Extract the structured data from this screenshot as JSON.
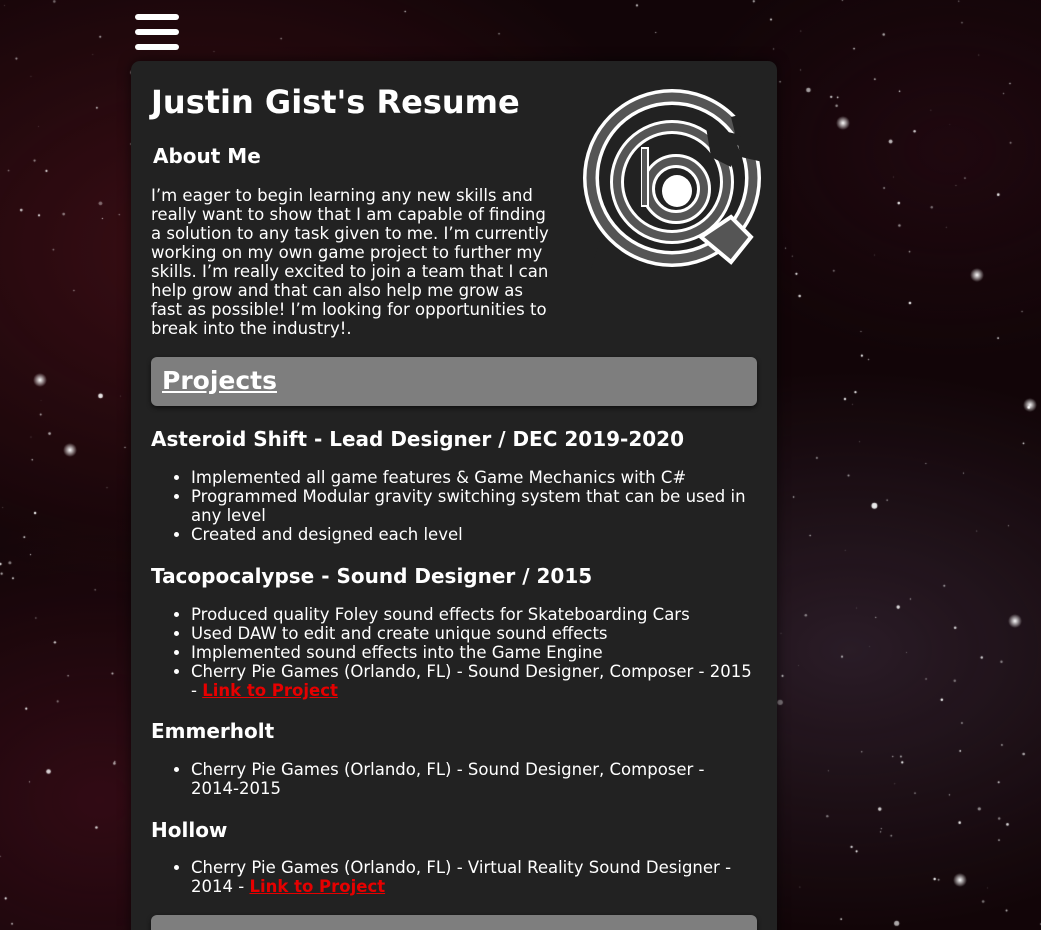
{
  "page": {
    "title": "Justin Gist's Resume"
  },
  "menu": {
    "icon": "hamburger-menu-icon"
  },
  "about": {
    "heading": "About Me",
    "text": "I’m eager to begin learning any new skills and really want to show that I am capable of finding a solution to any task given to me. I’m currently working on my own game project to further my skills. I’m really excited to join a team that I can help grow and that can also help me grow as fast as possible! I’m looking for opportunities to break into the industry!."
  },
  "logo": {
    "icon": "personal-logo-icon"
  },
  "projects_section": {
    "label": "Projects"
  },
  "projects": [
    {
      "title": "Asteroid Shift - Lead Designer / DEC 2019-2020",
      "bullets": [
        "Implemented all game features & Game Mechanics with C#",
        "Programmed Modular gravity switching system that can be used in any level",
        "Created and designed each level"
      ]
    },
    {
      "title": "Tacopocalypse - Sound Designer / 2015",
      "bullets": [
        "Produced quality Foley sound effects for Skateboarding Cars",
        "Used DAW to edit and create unique sound effects",
        "Implemented sound effects into the Game Engine",
        "Cherry Pie Games (Orlando, FL) - Sound Designer, Composer - 2015 - "
      ],
      "link": "Link to Project"
    },
    {
      "title": "Emmerholt",
      "bullets": [
        "Cherry Pie Games (Orlando, FL) - Sound Designer, Composer - 2014-2015"
      ]
    },
    {
      "title": "Hollow",
      "bullets": [
        "Cherry Pie Games (Orlando, FL) - Virtual Reality Sound Designer - 2014 - "
      ],
      "link": "Link to Project"
    }
  ],
  "colors": {
    "card_background": "#222222",
    "section_bar": "#7e7e7e",
    "link": "#e60000",
    "text": "#ffffff"
  }
}
